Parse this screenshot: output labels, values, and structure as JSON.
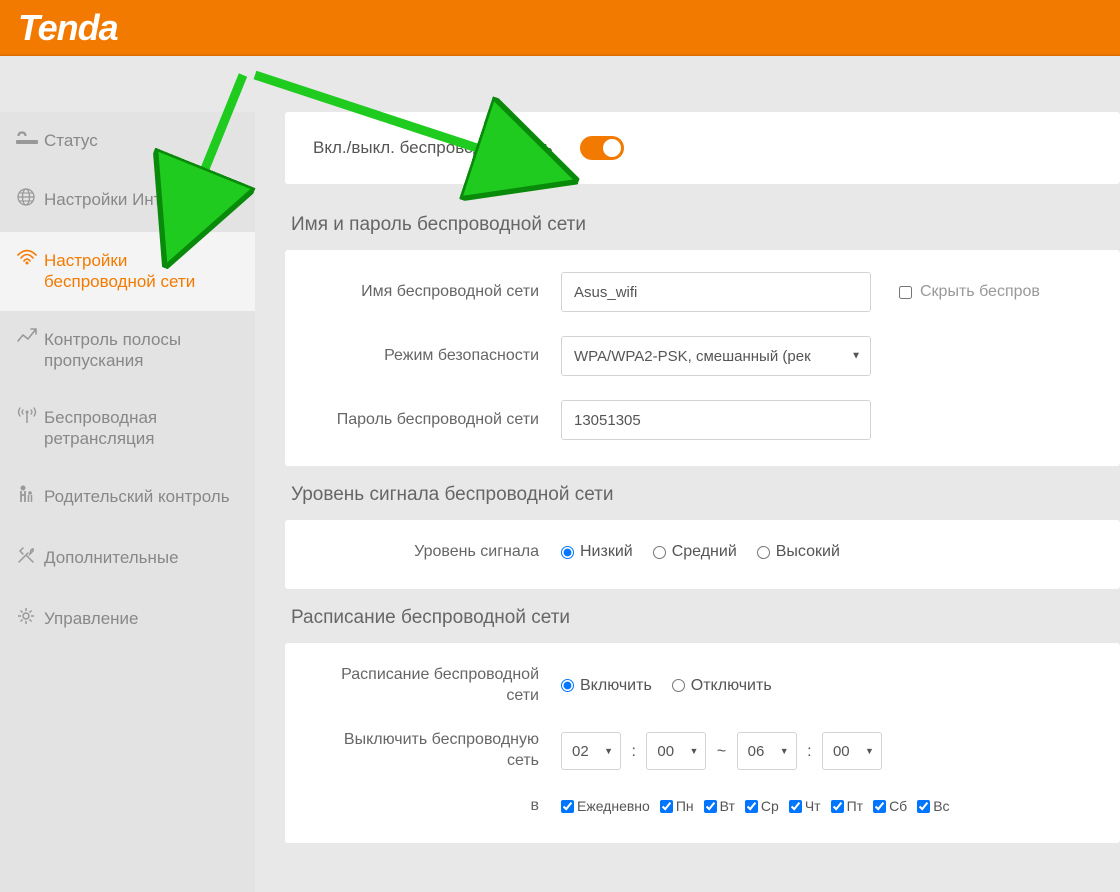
{
  "brand": "Tenda",
  "sidebar": {
    "items": [
      {
        "label": "Статус",
        "icon": "signal"
      },
      {
        "label": "Настройки Интернета",
        "icon": "globe"
      },
      {
        "label": "Настройки беспроводной сети",
        "icon": "wifi",
        "active": true
      },
      {
        "label": "Контроль полосы пропускания",
        "icon": "chart"
      },
      {
        "label": "Беспроводная ретрансляция",
        "icon": "retrans"
      },
      {
        "label": "Родительский контроль",
        "icon": "parent"
      },
      {
        "label": "Дополнительные",
        "icon": "tools"
      },
      {
        "label": "Управление",
        "icon": "gear"
      }
    ]
  },
  "wireless_toggle": {
    "label": "Вкл./выкл. беспроводную сеть",
    "enabled": true
  },
  "network_section": {
    "title": "Имя и пароль беспроводной сети",
    "ssid_label": "Имя беспроводной сети",
    "ssid_value": "Asus_wifi",
    "hide_label": "Скрыть беспров",
    "security_label": "Режим безопасности",
    "security_value": "WPA/WPA2-PSK, смешанный (рек",
    "password_label": "Пароль беспроводной сети",
    "password_value": "13051305"
  },
  "signal_section": {
    "title": "Уровень сигнала беспроводной сети",
    "label": "Уровень сигнала",
    "options": [
      "Низкий",
      "Средний",
      "Высокий"
    ],
    "selected": "Низкий"
  },
  "schedule_section": {
    "title": "Расписание беспроводной сети",
    "enable_label": "Расписание беспроводной сети",
    "enable_options": [
      "Включить",
      "Отключить"
    ],
    "enable_selected": "Включить",
    "turnoff_label": "Выключить беспроводную сеть",
    "time_from_h": "02",
    "time_from_m": "00",
    "time_to_h": "06",
    "time_to_m": "00",
    "days_prefix": "в",
    "days": [
      "Ежедневно",
      "Пн",
      "Вт",
      "Ср",
      "Чт",
      "Пт",
      "Сб",
      "Вс"
    ]
  }
}
